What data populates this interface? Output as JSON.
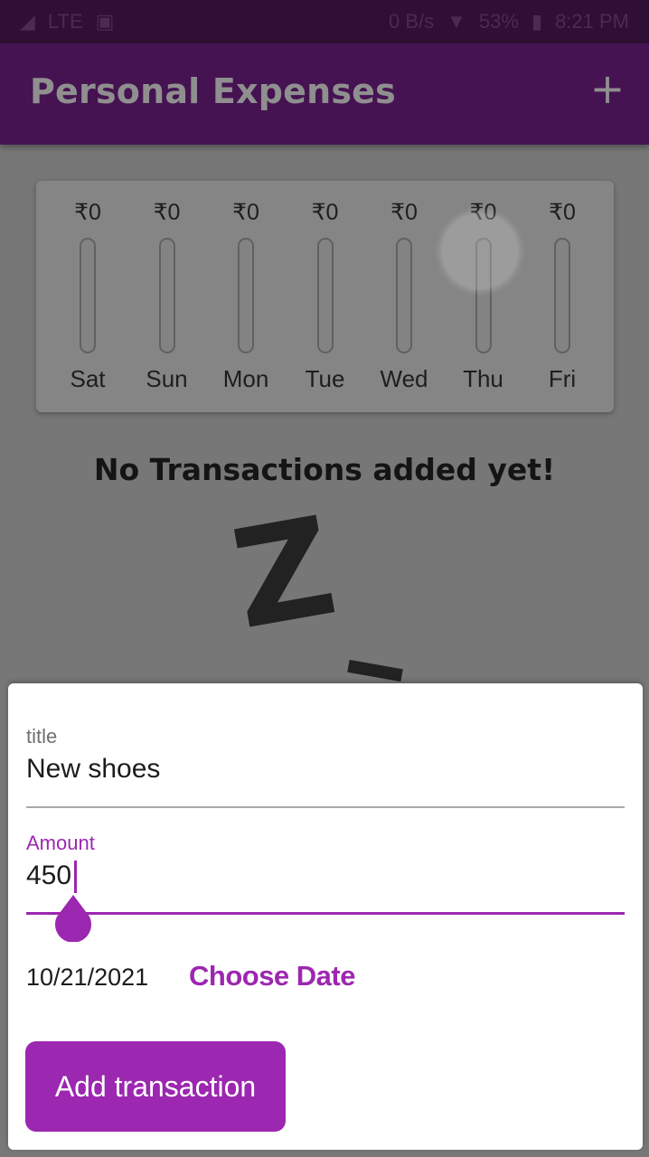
{
  "status_bar": {
    "network": "LTE",
    "speed": "0 B/s",
    "battery": "53%",
    "time": "8:21 PM"
  },
  "app_bar": {
    "title": "Personal Expenses",
    "add_icon": "plus-icon"
  },
  "chart": {
    "days": [
      {
        "day": "Sat",
        "amount": "₹0",
        "fraction": 0
      },
      {
        "day": "Sun",
        "amount": "₹0",
        "fraction": 0
      },
      {
        "day": "Mon",
        "amount": "₹0",
        "fraction": 0
      },
      {
        "day": "Tue",
        "amount": "₹0",
        "fraction": 0
      },
      {
        "day": "Wed",
        "amount": "₹0",
        "fraction": 0
      },
      {
        "day": "Thu",
        "amount": "₹0",
        "fraction": 0
      },
      {
        "day": "Fri",
        "amount": "₹0",
        "fraction": 0
      }
    ]
  },
  "empty_state": {
    "message": "No Transactions added yet!",
    "illustration": "Z"
  },
  "form": {
    "title_label": "title",
    "title_value": "New shoes",
    "amount_label": "Amount",
    "amount_value": "450",
    "date_value": "10/21/2021",
    "choose_date_label": "Choose Date",
    "submit_label": "Add transaction"
  },
  "colors": {
    "accent": "#9c27b0",
    "app_bar": "#461352",
    "scrim": "#777777"
  }
}
